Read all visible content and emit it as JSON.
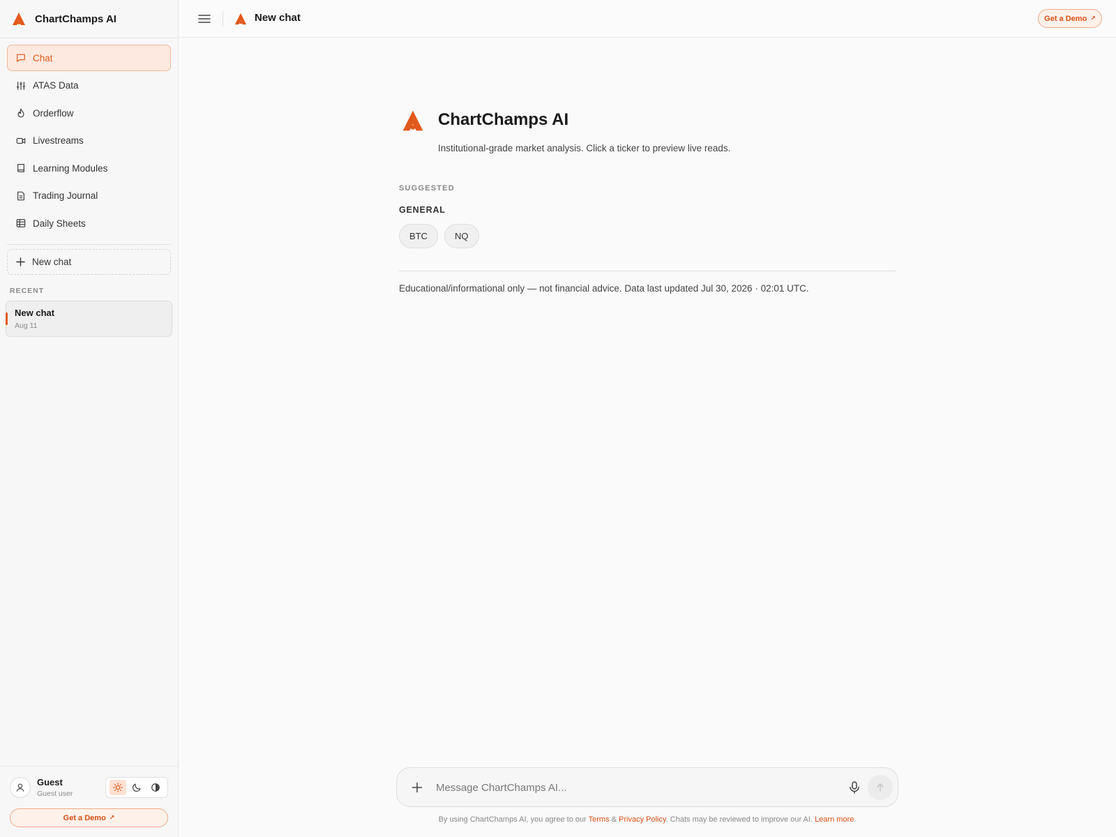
{
  "app": {
    "name": "ChartChamps AI",
    "accent": "#e2591c"
  },
  "sidebar": {
    "items": [
      {
        "label": "Chat",
        "icon": "chat-bubble-icon",
        "active": true
      },
      {
        "label": "ATAS Data",
        "icon": "sliders-icon",
        "active": false
      },
      {
        "label": "Orderflow",
        "icon": "flame-icon",
        "active": false
      },
      {
        "label": "Livestreams",
        "icon": "video-icon",
        "active": false
      },
      {
        "label": "Learning Modules",
        "icon": "book-icon",
        "active": false
      },
      {
        "label": "Trading Journal",
        "icon": "document-icon",
        "active": false
      },
      {
        "label": "Daily Sheets",
        "icon": "table-icon",
        "active": false
      }
    ],
    "new_chat_label": "New chat",
    "recent_label": "RECENT",
    "recent": [
      {
        "title": "New chat",
        "date": "Aug 11"
      }
    ],
    "user": {
      "name": "Guest",
      "role": "Guest user"
    },
    "theme_options": [
      {
        "icon": "sun-icon",
        "active": true
      },
      {
        "icon": "moon-icon",
        "active": false
      },
      {
        "icon": "contrast-icon",
        "active": false
      }
    ],
    "demo_label": "Get a Demo"
  },
  "topbar": {
    "title": "New chat",
    "demo_label": "Get a Demo",
    "arrow": "↗"
  },
  "main": {
    "title": "ChartChamps AI",
    "subtitle": "Institutional-grade market analysis. Click a ticker to preview live reads.",
    "suggested_label": "SUGGESTED",
    "category_label": "GENERAL",
    "chips": [
      "BTC",
      "NQ"
    ],
    "disclaimer": "Educational/informational only — not financial advice. Data last updated Jul 30, 2026 · 02:01 UTC."
  },
  "composer": {
    "placeholder": "Message ChartChamps AI...",
    "value": ""
  },
  "footer": {
    "prefix": "By using ChartChamps AI, you agree to our ",
    "terms": "Terms",
    "amp": " & ",
    "privacy": "Privacy Policy",
    "middle": ". Chats may be reviewed to improve our AI. ",
    "learn_more": "Learn more",
    "suffix": "."
  }
}
